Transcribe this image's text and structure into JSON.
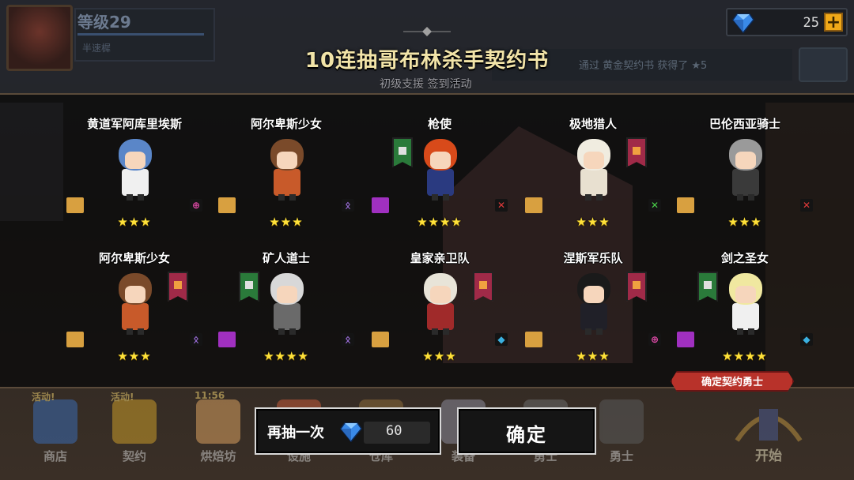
{
  "header": {
    "level": "等级29",
    "level_sub": "半速樨",
    "gems": "25",
    "plus": "+",
    "notice": "通过 黄金契约书 获得了 ★5"
  },
  "dialog": {
    "title": "10连抽哥布林杀手契约书",
    "subtitle": "初级支援   签到活动",
    "confirm_tag": "确定契约勇士"
  },
  "heroes": [
    {
      "name": "黄道军阿库里埃斯",
      "stars": "★★★",
      "elem": "⊕",
      "elem_color": "#e04aa8",
      "scroll_color": "#d8a040",
      "hair": "#5a86c8",
      "body": "#f0f0f0",
      "badge": null
    },
    {
      "name": "阿尔卑斯少女",
      "stars": "★★★",
      "elem": "ᛟ",
      "elem_color": "#a070e0",
      "scroll_color": "#d8a040",
      "hair": "#7a4a2a",
      "body": "#c85a2a",
      "badge": null
    },
    {
      "name": "枪使",
      "stars": "★★★★",
      "elem": "✕",
      "elem_color": "#e03a3a",
      "scroll_color": "#a030c0",
      "hair": "#d84a1a",
      "body": "#2a3a80",
      "badge": "green"
    },
    {
      "name": "极地猎人",
      "stars": "★★★",
      "elem": "✕",
      "elem_color": "#4ad04a",
      "scroll_color": "#d8a040",
      "hair": "#f0ece0",
      "body": "#e8e0d0",
      "badge": "red"
    },
    {
      "name": "巴伦西亚骑士",
      "stars": "★★★",
      "elem": "✕",
      "elem_color": "#e03a3a",
      "scroll_color": "#d8a040",
      "hair": "#9a9a9a",
      "body": "#3a3a3a",
      "badge": null
    },
    {
      "name": "阿尔卑斯少女",
      "stars": "★★★",
      "elem": "ᛟ",
      "elem_color": "#a070e0",
      "scroll_color": "#d8a040",
      "hair": "#7a4a2a",
      "body": "#c85a2a",
      "badge": "red"
    },
    {
      "name": "矿人道士",
      "stars": "★★★★",
      "elem": "ᛟ",
      "elem_color": "#a070e0",
      "scroll_color": "#a030c0",
      "hair": "#d8d8d8",
      "body": "#6a6a6a",
      "badge": "green"
    },
    {
      "name": "皇家亲卫队",
      "stars": "★★★",
      "elem": "◆",
      "elem_color": "#3ab0e0",
      "scroll_color": "#d8a040",
      "hair": "#e8e4d8",
      "body": "#a02a2a",
      "badge": "red"
    },
    {
      "name": "涅斯军乐队",
      "stars": "★★★",
      "elem": "⊕",
      "elem_color": "#e04aa8",
      "scroll_color": "#d8a040",
      "hair": "#1a1a1a",
      "body": "#202028",
      "badge": "red"
    },
    {
      "name": "剑之圣女",
      "stars": "★★★★",
      "elem": "◆",
      "elem_color": "#3ab0e0",
      "scroll_color": "#a030c0",
      "hair": "#f0e8a0",
      "body": "#f0f0f0",
      "badge": "green"
    }
  ],
  "actions": {
    "redraw_label": "再抽一次",
    "redraw_cost": "60",
    "confirm_label": "确定"
  },
  "nav": [
    {
      "label": "商店",
      "badge": "活动!",
      "color": "#3a6ab0"
    },
    {
      "label": "契约",
      "badge": "活动!",
      "color": "#c89a2a"
    },
    {
      "label": "烘焙坊",
      "badge": "11:56",
      "color": "#d8a060"
    },
    {
      "label": "设施",
      "badge": "",
      "color": "#c05a3a"
    },
    {
      "label": "仓库",
      "badge": "",
      "color": "#8a6a3a"
    },
    {
      "label": "装备",
      "badge": "",
      "color": "#8a8a9a"
    },
    {
      "label": "勇士",
      "badge": "",
      "color": "#6a6a6a"
    },
    {
      "label": "勇士",
      "badge": "",
      "color": "#5a5a5a"
    }
  ],
  "start_label": "开始",
  "colors": {
    "gem": "#3a8ae8",
    "star": "#ffe23a",
    "title": "#f2e4a8",
    "tag": "#b8322a"
  }
}
